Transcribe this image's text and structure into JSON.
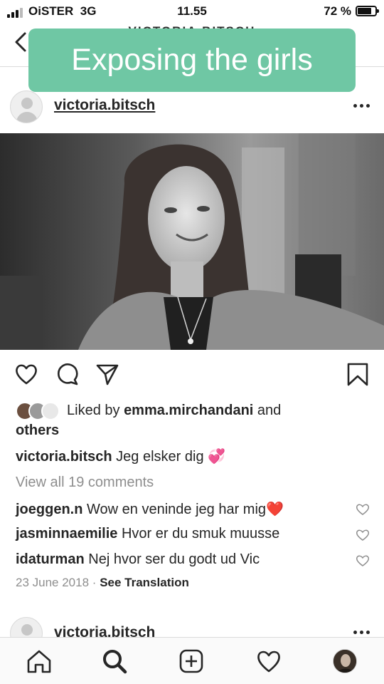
{
  "status_bar": {
    "carrier": "OiSTER",
    "network": "3G",
    "time": "11.55",
    "battery_percent": "72 %"
  },
  "header": {
    "title": "VICTORIA.BITSCH",
    "back_icon": "chevron-left-icon"
  },
  "overlay_caption": "Exposing the girls",
  "post": {
    "username": "victoria.bitsch",
    "more_icon": "ellipsis-icon",
    "actions": [
      "heart-icon",
      "comment-icon",
      "share-icon",
      "bookmark-icon"
    ],
    "likes": {
      "prefix": "Liked by ",
      "user": "emma.mirchandani",
      "middle": " and",
      "suffix": "others"
    },
    "caption": {
      "username": "victoria.bitsch",
      "text": "Jeg elsker dig",
      "emoji": "💞"
    },
    "view_all_comments": "View all 19 comments",
    "comments": [
      {
        "username": "joeggen.n",
        "text": "Wow en veninde jeg har mig",
        "emoji": "❤️"
      },
      {
        "username": "jasminnaemilie",
        "text": "Hvor er du smuk muusse",
        "emoji": ""
      },
      {
        "username": "idaturman",
        "text": "Nej hvor ser du godt ud Vic",
        "emoji": ""
      }
    ],
    "date": "23 June 2018",
    "separator": "·",
    "see_translation": "See Translation"
  },
  "next_post": {
    "username": "victoria.bitsch"
  },
  "tab_bar": {
    "items": [
      "home-icon",
      "search-icon",
      "add-post-icon",
      "activity-heart-icon",
      "profile-avatar"
    ]
  },
  "colors": {
    "overlay_bg": "#6fc7a4",
    "text": "#262626",
    "muted": "#8e8e8e",
    "divider": "#dbdbdb"
  }
}
